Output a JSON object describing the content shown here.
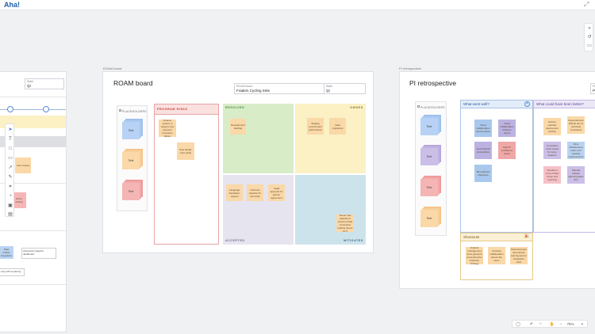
{
  "app": {
    "logo": "Aha!"
  },
  "left_partial": {
    "state_label": "State",
    "state_value": "QI",
    "sticky_text": "User testing",
    "sticky2_text": "Extra testing",
    "mini_card1": "Server rendering",
    "mini_card2": "Advanced analytics dashboard",
    "mini_badge": "SUM",
    "mini_card3": "Lazy API rendering",
    "mini_left": "Data master integration"
  },
  "roam": {
    "frame_label": "ROAM board",
    "title": "ROAM board",
    "field1_label": "ROAM board",
    "field1_value": "Fradem Cycling risks",
    "field2_label": "State",
    "field2_value": "QI",
    "placeholders_label": "PLACEHOLDERS",
    "stack_labels": [
      "Text",
      "Text",
      "Text"
    ],
    "program_risks": "PROGRAM RISKS",
    "resolved": "RESOLVED",
    "owned": "OWNED",
    "accepted": "ACCEPTED",
    "mitigated": "MITIGATED",
    "stickies": {
      "pr1": "Finance system to support new payment processor failure",
      "pr2": "New design rules guide",
      "res1": "Development backlog",
      "own1": "Staging environment performance",
      "own2": "Data migrations",
      "acc1": "Language translation support",
      "acc2": "Unknown capacity for new team",
      "acc3": "Legal approval for partner agreement",
      "mit1": "Server rate capacity to preserve data connection loading issues for 5"
    }
  },
  "pi": {
    "frame_label": "PI retrospective",
    "title": "PI retrospective",
    "field_label": "PI",
    "field_value": "PI",
    "placeholders_label": "PLACEHOLDERS",
    "stack_labels": [
      "Text",
      "Text",
      "Text",
      "Text"
    ],
    "went_well": "What went well?",
    "could_be_better": "What could have been better?",
    "shoutouts": "Shoutouts",
    "stickies": {
      "ww1": "Good collaboration across teams",
      "ww2": "Great collaboration between teams",
      "ww3": "Good kickoff presentation",
      "ww4": "High PI confidence levels",
      "ww5": "Met planned objectives",
      "cb1": "Hard to maintain deployment velocity",
      "cb2": "Dependencies difficult due to technical constraints",
      "cb3": "Consistent code review for some features",
      "cb4": "More infrastructure plans and capacity improvements",
      "cb5": "Needed a more unified scope and reporting",
      "cb6": "Manual release planning takes time",
      "so1": "Product management did a great job presenting the business strategy",
      "so2": "Amazing collaboration across the team",
      "so3": "Technical team went above and beyond on integration work"
    }
  },
  "bottom": {
    "zoom": "75%"
  }
}
